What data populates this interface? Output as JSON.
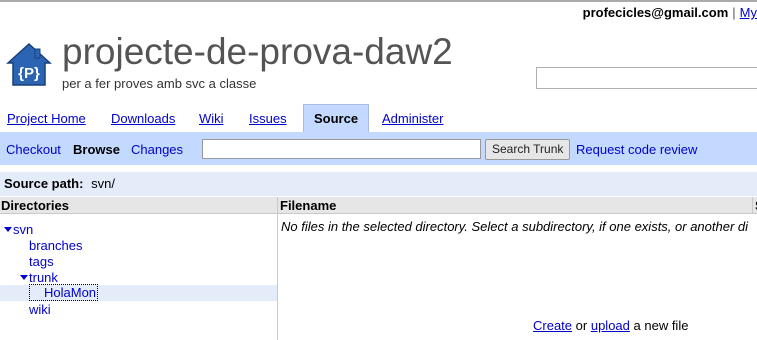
{
  "user": {
    "email": "profecicles@gmail.com",
    "separator": "|",
    "my_link": "My"
  },
  "project": {
    "name": "projecte-de-prova-daw2",
    "summary": "per a fer proves amb svc a classe",
    "logo_letter": "{P}"
  },
  "tabs": [
    {
      "label": "Project Home",
      "active": false
    },
    {
      "label": "Downloads",
      "active": false
    },
    {
      "label": "Wiki",
      "active": false
    },
    {
      "label": "Issues",
      "active": false
    },
    {
      "label": "Source",
      "active": true
    },
    {
      "label": "Administer",
      "active": false
    }
  ],
  "subnav": {
    "checkout": "Checkout",
    "browse": "Browse",
    "changes": "Changes",
    "search_value": "",
    "search_button": "Search Trunk",
    "request_review": "Request code review"
  },
  "source_path": {
    "label": "Source path:",
    "value": "svn/"
  },
  "columns": {
    "directories": "Directories",
    "filename": "Filename",
    "extra": "S"
  },
  "tree": {
    "svn": "svn",
    "branches": "branches",
    "tags": "tags",
    "trunk": "trunk",
    "holamon": "HolaMon",
    "wiki": "wiki"
  },
  "files": {
    "empty_message": "No files in the selected directory. Select a subdirectory, if one exists, or another di",
    "create": "Create",
    "or": "or",
    "upload": "upload",
    "new_file": "a new file"
  },
  "colors": {
    "accent": "#c3d9ff",
    "link": "#0000cc",
    "logo": "#2c64b4",
    "selected_row": "#e5ecf9"
  }
}
